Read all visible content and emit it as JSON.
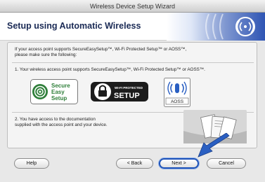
{
  "window": {
    "title": "Wireless Device Setup Wizard"
  },
  "header": {
    "title": "Setup using Automatic Wireless"
  },
  "intro": {
    "line1": "If your access point supports SecureEasySetup™, Wi-Fi Protected Setup™ or AOSS™,",
    "line2": "please make sure the following:"
  },
  "item1": {
    "text": "1. Your wireless access point supports SecureEasySetup™, Wi-Fi Protected Setup™ or AOSS™."
  },
  "logos": {
    "ses": {
      "line1": "Secure",
      "line2": "Easy",
      "line3": "Setup"
    },
    "wps": {
      "small": "WI-FI PROTECTED",
      "big": "SETUP"
    },
    "aoss": {
      "text": "AOSS"
    }
  },
  "item2": {
    "line1": "2. You have access to the documentation",
    "line2": "supplied with the access point and your device."
  },
  "buttons": {
    "help": "Help",
    "back": "< Back",
    "next": "Next >",
    "cancel": "Cancel"
  },
  "colors": {
    "accent": "#1d52b8",
    "header_title": "#1a2a55",
    "ses_green": "#2f7f3a",
    "arrow_blue": "#2a5fc2"
  }
}
